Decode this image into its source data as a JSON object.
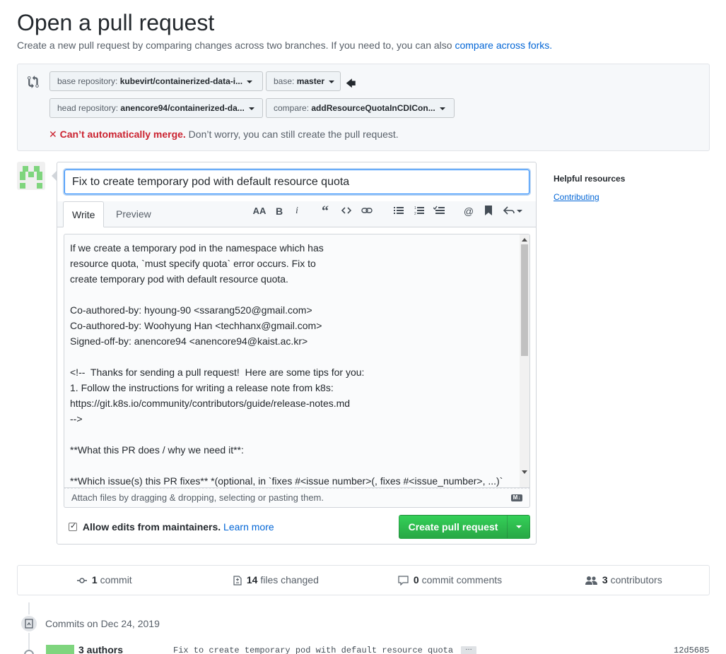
{
  "header": {
    "title": "Open a pull request",
    "subtitle_prefix": "Create a new pull request by comparing changes across two branches. If you need to, you can also ",
    "subtitle_link": "compare across forks."
  },
  "range": {
    "base_repo_label": "base repository:",
    "base_repo_value": "kubevirt/containerized-data-i...",
    "base_label": "base:",
    "base_value": "master",
    "head_repo_label": "head repository:",
    "head_repo_value": "anencore94/containerized-da...",
    "compare_label": "compare:",
    "compare_value": "addResourceQuotaInCDICon...",
    "merge_status_icon": "✕",
    "merge_status_bad": "Can’t automatically merge.",
    "merge_status_rest": " Don’t worry, you can still create the pull request."
  },
  "form": {
    "title_value": "Fix to create temporary pod with default resource quota",
    "tabs": [
      "Write",
      "Preview"
    ],
    "toolbar_icons": [
      "text-size-icon",
      "bold-icon",
      "italic-icon",
      "quote-icon",
      "code-icon",
      "link-icon",
      "unordered-list-icon",
      "ordered-list-icon",
      "task-list-icon",
      "mention-icon",
      "bookmark-icon",
      "reply-icon"
    ],
    "body_text": "If we create a temporary pod in the namespace which has\nresource quota, `must specify quota` error occurs. Fix to\ncreate temporary pod with default resource quota.\n\nCo-authored-by: hyoung-90 <ssarang520@gmail.com>\nCo-authored-by: Woohyung Han <techhanx@gmail.com>\nSigned-off-by: anencore94 <anencore94@kaist.ac.kr>\n\n<!--  Thanks for sending a pull request!  Here are some tips for you:\n1. Follow the instructions for writing a release note from k8s:\nhttps://git.k8s.io/community/contributors/guide/release-notes.md\n-->\n\n**What this PR does / why we need it**:\n\n**Which issue(s) this PR fixes** *(optional, in `fixes #<issue number>(, fixes #<issue_number>, ...)`",
    "attach_text": "Attach files by dragging & dropping, selecting or pasting them.",
    "markdown_badge": "M↓",
    "allow_edits_label": "Allow edits from maintainers.",
    "learn_more": "Learn more",
    "create_button": "Create pull request"
  },
  "sidebar": {
    "heading": "Helpful resources",
    "link": "Contributing"
  },
  "stats": {
    "commits_count": "1",
    "commits_label": "commit",
    "files_count": "14",
    "files_label": "files changed",
    "comments_count": "0",
    "comments_label": "commit comments",
    "contributors_count": "3",
    "contributors_label": "contributors"
  },
  "timeline": {
    "commits_on": "Commits on Dec 24, 2019",
    "authors": "3 authors",
    "commit_message": "Fix to create temporary pod with default resource quota",
    "more": "…",
    "sha": "12d5685"
  },
  "colors": {
    "link": "#0366d6",
    "error": "#cb2431",
    "primary_button": "#28a745"
  }
}
